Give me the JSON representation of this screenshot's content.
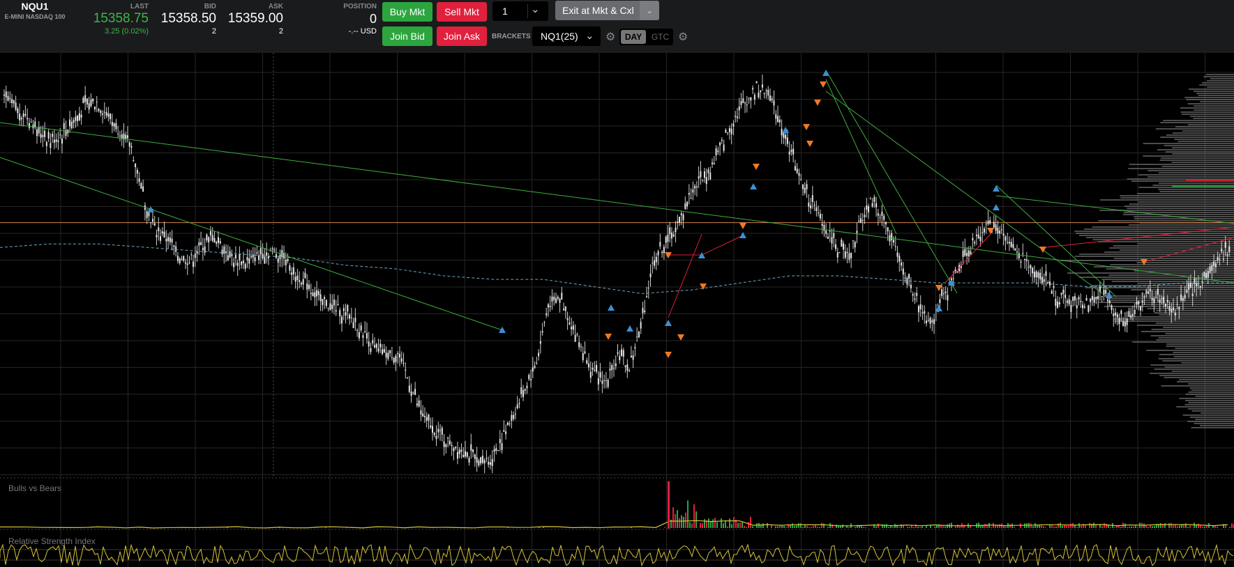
{
  "symbol": {
    "code": "NQU1",
    "description": "E-MINI NASDAQ 100"
  },
  "quote": {
    "last_label": "LAST",
    "last": "15358.75",
    "change": "3.25 (0.02%)",
    "bid_label": "BID",
    "bid": "15358.50",
    "bid_size": "2",
    "ask_label": "ASK",
    "ask": "15359.00",
    "ask_size": "2"
  },
  "position": {
    "label": "POSITION",
    "value": "0",
    "pnl": "-.-- USD"
  },
  "buttons": {
    "buy_mkt": "Buy Mkt",
    "sell_mkt": "Sell Mkt",
    "join_bid": "Join Bid",
    "join_ask": "Join Ask",
    "exit": "Exit at Mkt & Cxl"
  },
  "order": {
    "quantity": "1"
  },
  "brackets": {
    "label": "BRACKETS",
    "value": "NQ1(25)"
  },
  "tif": {
    "day": "DAY",
    "gtc": "GTC"
  },
  "icons": {
    "dropdown": "chevron-down-icon",
    "settings": "gear-icon"
  },
  "indicators": {
    "bulls_vs_bears": "Bulls vs Bears",
    "rsi": "Relative Strength Index"
  },
  "colors": {
    "bg": "#000000",
    "toolbar": "#1a1b1d",
    "green": "#2da53f",
    "red": "#e0203d",
    "up_marker": "#3d8fd6",
    "down_marker": "#f07a22",
    "vwap": "#6fa8c8",
    "level_line": "#d9844a",
    "trend_green": "#3fae3f",
    "trend_red": "#e0203d",
    "rsi": "#d7c33b"
  },
  "chart_data": {
    "type": "candlestick",
    "instrument": "NQU1",
    "price_range": [
      15294,
      15408
    ],
    "horizontal_level": 15366,
    "close_path": [
      15401,
      15398,
      15396,
      15392,
      15389,
      15391,
      15395,
      15399,
      15400,
      15396,
      15392,
      15387,
      15374,
      15364,
      15362,
      15357,
      15355,
      15359,
      15362,
      15359,
      15355,
      15355,
      15357,
      15358,
      15357,
      15352,
      15349,
      15345,
      15343,
      15341,
      15339,
      15335,
      15330,
      15329,
      15329,
      15321,
      15312,
      15308,
      15305,
      15303,
      15301,
      15299,
      15299,
      15305,
      15312,
      15319,
      15327,
      15343,
      15345,
      15337,
      15330,
      15323,
      15321,
      15329,
      15325,
      15337,
      15354,
      15360,
      15364,
      15372,
      15378,
      15381,
      15388,
      15395,
      15400,
      15404,
      15403,
      15395,
      15386,
      15376,
      15370,
      15364,
      15359,
      15356,
      15367,
      15372,
      15367,
      15358,
      15350,
      15343,
      15338,
      15344,
      15350,
      15357,
      15361,
      15366,
      15364,
      15359,
      15356,
      15352,
      15350,
      15345,
      15344,
      15343,
      15344,
      15346,
      15340,
      15339,
      15343,
      15346,
      15344,
      15341,
      15345,
      15348,
      15352,
      15356,
      15359
    ],
    "vwap_path": [
      15359,
      15360,
      15360,
      15359,
      15358,
      15357,
      15356,
      15354,
      15353,
      15351,
      15350,
      15350,
      15348,
      15346,
      15347,
      15349,
      15351,
      15351,
      15350,
      15349,
      15349,
      15349,
      15348,
      15348,
      15349,
      15349
    ]
  }
}
